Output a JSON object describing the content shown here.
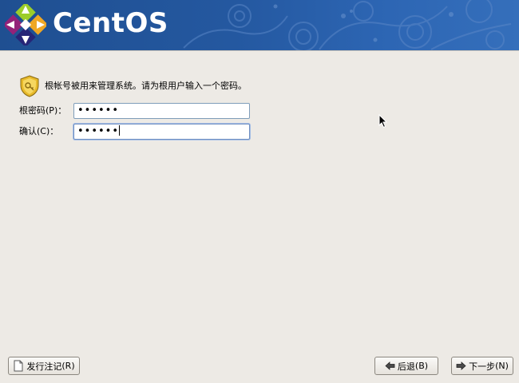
{
  "banner": {
    "brand": "CentOS",
    "colors": {
      "start": "#1f4f91",
      "end": "#356fbb"
    }
  },
  "content": {
    "info_icon": "shield-key-icon",
    "info_text": "根帐号被用来管理系统。请为根用户输入一个密码。",
    "password_field": {
      "label": "根密码",
      "mnemonic": "P",
      "value_masked": "••••••"
    },
    "confirm_field": {
      "label": "确认",
      "mnemonic": "C",
      "value_masked": "••••••"
    }
  },
  "footer": {
    "release_notes": {
      "label": "发行注记",
      "mnemonic": "R",
      "icon": "document-icon"
    },
    "back": {
      "label": "后退",
      "mnemonic": "B",
      "icon": "arrow-left-icon"
    },
    "next": {
      "label": "下一步",
      "mnemonic": "N",
      "icon": "arrow-right-icon"
    }
  }
}
